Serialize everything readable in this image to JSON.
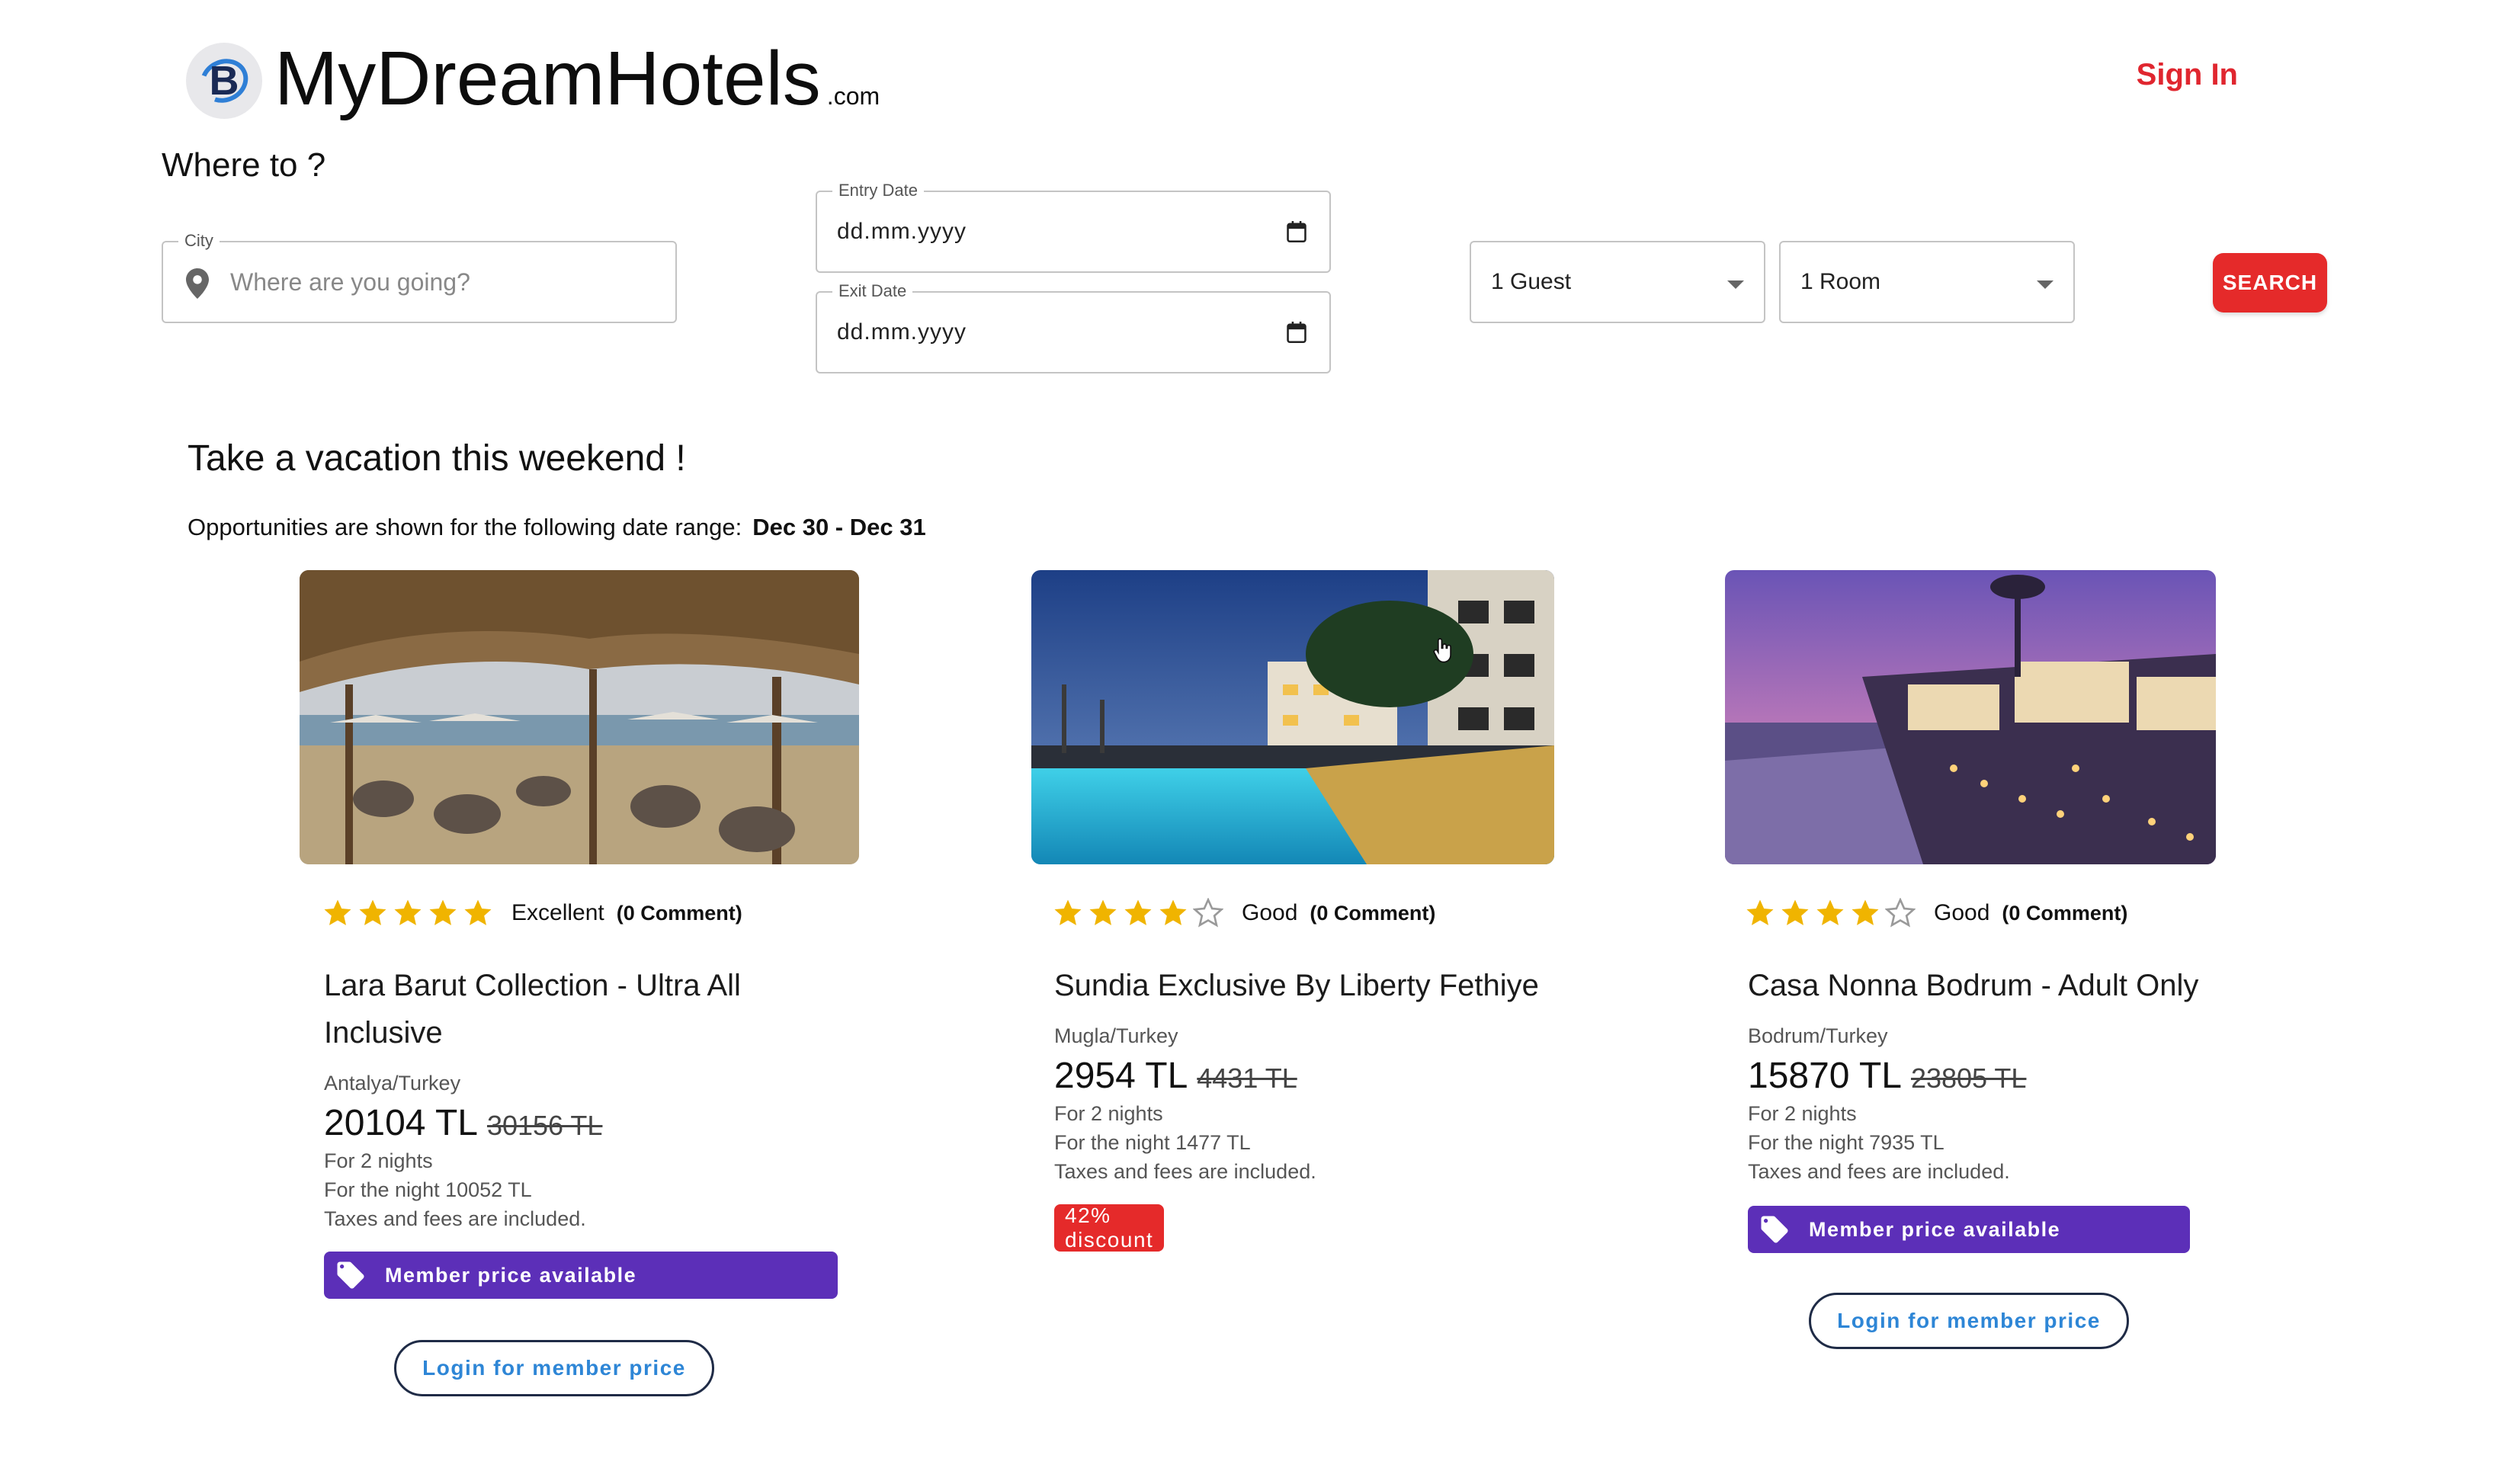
{
  "header": {
    "brand_letter": "B",
    "brand_name": "MyDreamHotels",
    "brand_suffix": ".com",
    "sign_in_label": "Sign In"
  },
  "search": {
    "title": "Where to ?",
    "city_label": "City",
    "city_placeholder": "Where are you going?",
    "entry_label": "Entry Date",
    "entry_value": "dd.mm.yyyy",
    "exit_label": "Exit Date",
    "exit_value": "dd.mm.yyyy",
    "guests_value": "1 Guest",
    "rooms_value": "1 Room",
    "search_label": "SEARCH"
  },
  "section": {
    "title": "Take a vacation this weekend !",
    "range_text": "Opportunities are shown for the following date range:",
    "range_value": "Dec 30 - Dec 31"
  },
  "hotels": [
    {
      "stars": 5,
      "rating_label": "Excellent",
      "comments": "(0 Comment)",
      "name_line1": "Lara Barut Collection - Ultra All",
      "name_line2": "Inclusive",
      "location": "Antalya/Turkey",
      "price": "20104 TL",
      "old_price": "30156 TL",
      "nights": "For 2 nights",
      "per_night": "For the night 10052 TL",
      "taxes": "Taxes and fees are included.",
      "member_label": "Member price available",
      "login_label": "Login for member price"
    },
    {
      "stars": 4,
      "rating_label": "Good",
      "comments": "(0 Comment)",
      "name_line1": "Sundia Exclusive By Liberty Fethiye",
      "location": "Mugla/Turkey",
      "price": "2954 TL",
      "old_price": "4431 TL",
      "nights": "For 2 nights",
      "per_night": "For the night 1477 TL",
      "taxes": "Taxes and fees are included.",
      "discount_label": "42% discount"
    },
    {
      "stars": 4,
      "rating_label": "Good",
      "comments": "(0 Comment)",
      "name_line1": "Casa Nonna Bodrum - Adult Only",
      "location": "Bodrum/Turkey",
      "price": "15870 TL",
      "old_price": "23805 TL",
      "nights": "For 2 nights",
      "per_night": "For the night 7935 TL",
      "taxes": "Taxes and fees are included.",
      "member_label": "Member price available",
      "login_label": "Login for member price"
    }
  ],
  "colors": {
    "accent_red": "#e52a2a",
    "member_purple": "#5c2fb8",
    "star_gold": "#f0b400",
    "link_blue": "#2e86d6"
  },
  "icons": [
    "location-pin-icon",
    "calendar-icon",
    "chevron-down-icon",
    "star-icon",
    "tag-icon",
    "hand-cursor-icon"
  ]
}
